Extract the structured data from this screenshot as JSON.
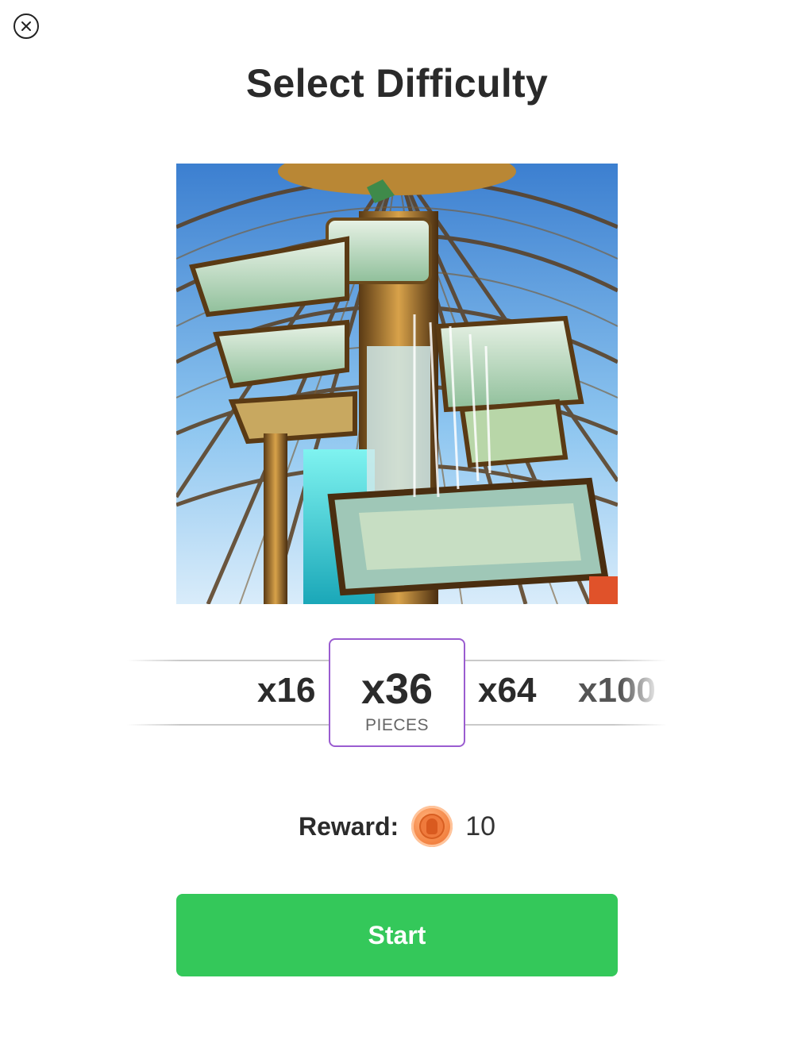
{
  "header": {
    "close_icon": "close-circle-icon",
    "title": "Select Difficulty"
  },
  "preview": {
    "subject": "puzzle-preview-image"
  },
  "difficulty": {
    "options": [
      {
        "label": "x16"
      },
      {
        "label": "x36",
        "unit": "PIECES",
        "selected": true
      },
      {
        "label": "x64"
      },
      {
        "label": "x100"
      }
    ],
    "accent_color": "#9a5cd0"
  },
  "reward": {
    "label": "Reward:",
    "icon": "coin-icon",
    "value": "10"
  },
  "actions": {
    "start_label": "Start",
    "start_color": "#34c85a"
  }
}
